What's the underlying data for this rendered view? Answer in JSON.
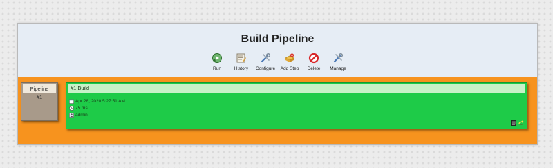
{
  "page": {
    "title": "Build Pipeline",
    "toolbar": [
      {
        "label": "Run",
        "icon": "run-icon"
      },
      {
        "label": "History",
        "icon": "history-icon"
      },
      {
        "label": "Configure",
        "icon": "configure-icon"
      },
      {
        "label": "Add Step",
        "icon": "add-step-icon"
      },
      {
        "label": "Delete",
        "icon": "delete-icon"
      },
      {
        "label": "Manage",
        "icon": "manage-icon"
      }
    ]
  },
  "pipeline": {
    "label": "Pipeline",
    "number": "#1"
  },
  "build": {
    "title": "#1 Build",
    "date": "Apr 28, 2020 5:27:51 AM",
    "duration": "75 ms",
    "user": "admin",
    "status_color": "#1ecb48"
  },
  "colors": {
    "frame": "#f7931e",
    "header": "#e6edf5",
    "pipeline_box": "#a89a8a"
  }
}
